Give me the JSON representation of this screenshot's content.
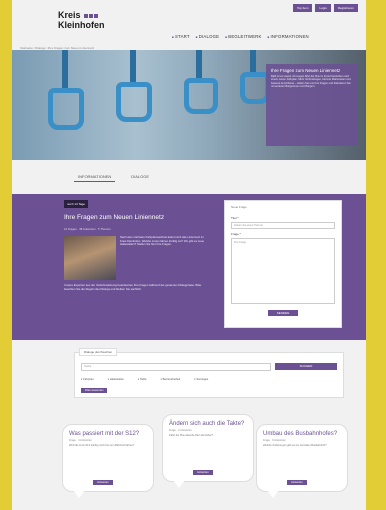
{
  "topbar": [
    "Top Item",
    "Login",
    "Registrieren"
  ],
  "logo": {
    "line1": "Kreis",
    "line2": "Kleinhofen"
  },
  "nav": [
    "START",
    "DIALOGE",
    "BEGLEITWERK",
    "INFORMATIONEN"
  ],
  "breadcrumb": "Startseite / Dialoge / Ihre Fragen zum Neuen Liniennetz",
  "hero": {
    "title": "Ihre Fragen zum Neuen Liniennetz",
    "body": "Bald ist es soweit: Ab August fährt der Bus im Kreis Kleinhofen nach einem neuen Fahrplan. Mehr Verbindungen, kürzere Wartezeiten und bessere Anschlüsse – stellen Sie uns Ihre Fragen und diskutieren Sie mit anderen Bürgerinnen und Bürgern."
  },
  "tabs": [
    "INFORMATIONEN",
    "DIALOGE"
  ],
  "dialog": {
    "badge": "noch 14 Tage",
    "title": "Ihre Fragen zum Neuen Liniennetz",
    "meta": "12 Fragen · 38 Antworten · 5 Themen",
    "text1": "Nach dem nächsten Fahrplanwechsel ändert sich das Liniennetz im Kreis Kleinhofen. Welche Linien fahren künftig wo? Wo gibt es neue Haltestellen? Stellen Sie hier Ihre Fragen.",
    "text2": "Unsere Experten aus der Verkehrsplanung beantworten Ihre Fragen während der gesamten Dialogphase. Bitte beachten Sie die Regeln des Dialogs und bleiben Sie sachlich."
  },
  "form": {
    "heading": "Neue Frage",
    "title_label": "Titel *",
    "title_placeholder": "Geben Sie einen Titel ein",
    "question_label": "Frage *",
    "question_placeholder": "Ihre Frage",
    "submit": "SENDEN"
  },
  "search": {
    "tab": "Dialoge durchsuchen",
    "placeholder": "Suche",
    "button": "SUCHEN",
    "options": [
      "Fahrplan",
      "Haltestellen",
      "Tarife",
      "Barrierefreiheit",
      "Sonstiges"
    ],
    "filter_button": "Filter anwenden"
  },
  "bubbles": [
    {
      "title": "Was passiert mit der S12?",
      "meta": "Frage · 4 Antworten",
      "text": "Wird die Linie S12 künftig noch bis zum Bahnhof fahren?",
      "button": "Antworten"
    },
    {
      "title": "Ändern sich auch die Takte?",
      "meta": "Frage · 2 Antworten",
      "text": "Fährt der Bus abends öfter als bisher?",
      "button": "Antworten"
    },
    {
      "title": "Umbau des Busbahnhofes?",
      "meta": "Frage · 6 Antworten",
      "text": "Welche Änderungen gibt es am zentralen Busbahnhof?",
      "button": "Antworten"
    }
  ]
}
